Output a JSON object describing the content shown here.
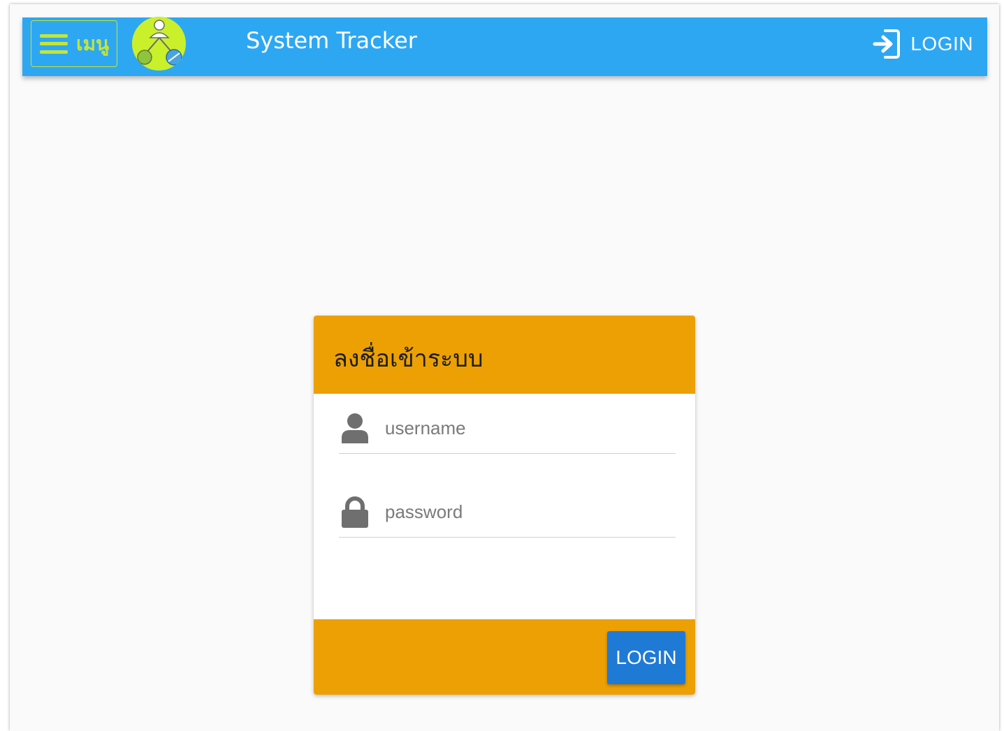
{
  "appbar": {
    "menu_label": "เมนู",
    "title": "System Tracker",
    "login_label": "LOGIN",
    "bg_color": "#2ea7f2",
    "accent_color": "#c4e538"
  },
  "login_card": {
    "title": "ลงชื่อเข้าระบบ",
    "username_placeholder": "username",
    "password_placeholder": "password",
    "submit_label": "LOGIN",
    "header_color": "#eca004",
    "button_color": "#1f7ad6"
  },
  "icons": {
    "menu": "hamburger-icon",
    "logo": "network-user-logo",
    "login": "login-enter-icon",
    "username": "person-icon",
    "password": "lock-icon"
  }
}
